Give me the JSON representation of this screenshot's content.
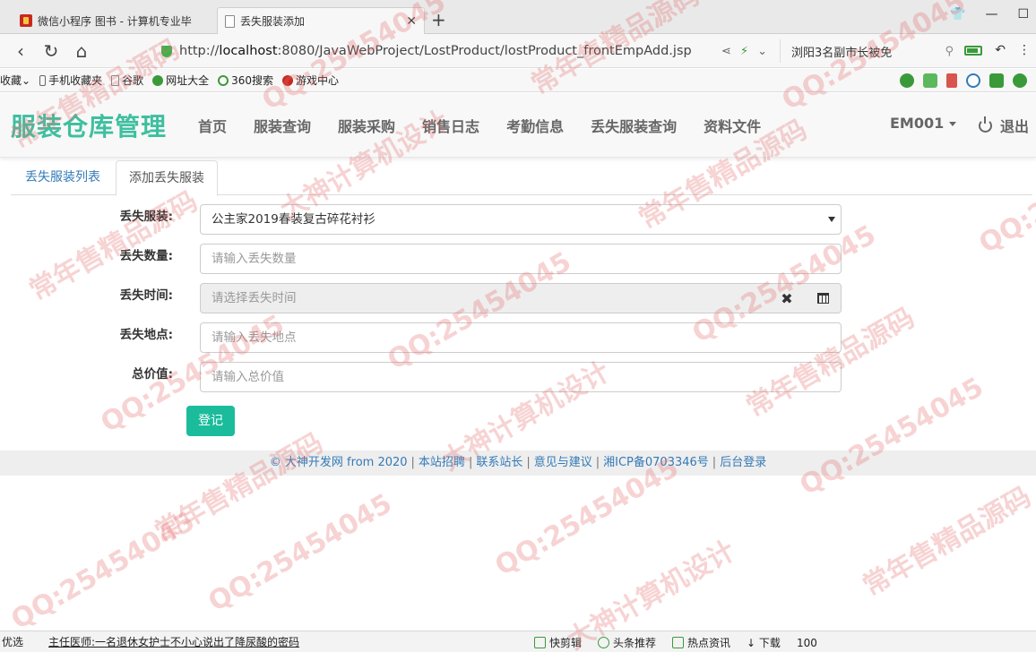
{
  "browser": {
    "tabs": [
      {
        "label": "微信小程序 图书 - 计算机专业毕"
      },
      {
        "label": "丢失服装添加"
      }
    ],
    "url_prefix": "http://",
    "url_host": "localhost",
    "url_rest": ":8080/JavaWebProject/LostProduct/lostProduct_frontEmpAdd.jsp",
    "news": "浏阳3名副市长被免",
    "bookmarks": [
      {
        "label": "收藏",
        "color": "#f0b429"
      },
      {
        "label": "手机收藏夹",
        "color": "#666666"
      },
      {
        "label": "谷歌",
        "color": "#888888"
      },
      {
        "label": "网址大全",
        "color": "#3a9a3a"
      },
      {
        "label": "360搜索",
        "color": "#f0b429"
      },
      {
        "label": "游戏中心",
        "color": "#c8291f"
      }
    ]
  },
  "site": {
    "brand": "服装仓库管理",
    "menu": [
      "首页",
      "服装查询",
      "服装采购",
      "销售日志",
      "考勤信息",
      "丢失服装查询",
      "资料文件"
    ],
    "user": "EM001",
    "logout": "退出"
  },
  "tabs": {
    "list": "丢失服装列表",
    "add": "添加丢失服装"
  },
  "form": {
    "product_label": "丢失服装:",
    "product_value": "公主家2019春装复古碎花衬衫",
    "quantity_label": "丢失数量:",
    "quantity_placeholder": "请输入丢失数量",
    "time_label": "丢失时间:",
    "time_placeholder": "请选择丢失时间",
    "place_label": "丢失地点:",
    "place_placeholder": "请输入丢失地点",
    "value_label": "总价值:",
    "value_placeholder": "请输入总价值",
    "submit": "登记"
  },
  "footer": {
    "copyright": "© 大神开发网 from 2020",
    "links": [
      "本站招聘",
      "联系站长",
      "意见与建议",
      "湘ICP备0703346号",
      "后台登录"
    ]
  },
  "statusbar": {
    "left": "优选",
    "news": "主任医师:一名退休女护士不小心说出了降尿酸的密码",
    "items": [
      "快剪辑",
      "头条推荐",
      "热点资讯",
      "下载",
      "100"
    ]
  },
  "watermark": {
    "qq": "QQ:25454045",
    "a": "常年售精品源码",
    "b": "大神计算机设计"
  },
  "colors": {
    "brand": "#3fbfa0",
    "primary_btn": "#1abc9c",
    "link": "#337ab7"
  }
}
